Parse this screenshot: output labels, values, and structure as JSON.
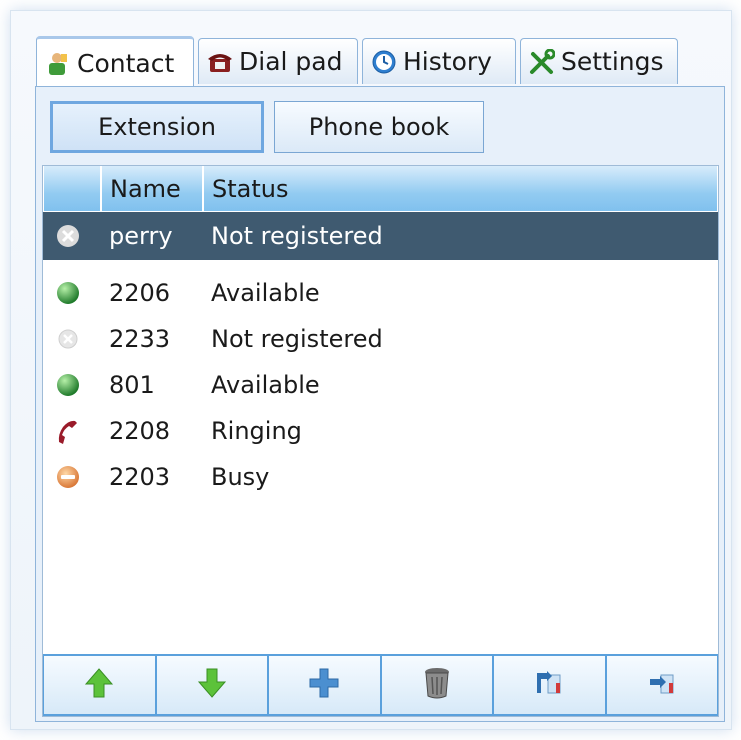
{
  "tabs": [
    {
      "label": "Contact",
      "icon": "contact-icon",
      "active": true
    },
    {
      "label": "Dial pad",
      "icon": "telephone-icon",
      "active": false
    },
    {
      "label": "History",
      "icon": "clock-icon",
      "active": false
    },
    {
      "label": "Settings",
      "icon": "tools-icon",
      "active": false
    }
  ],
  "segments": {
    "extension": "Extension",
    "phone_book": "Phone book"
  },
  "table": {
    "columns": [
      "",
      "Name",
      "Status"
    ],
    "rows": [
      {
        "name": "perry",
        "status": "Not registered",
        "icon": "not-registered-icon",
        "selected": true
      },
      {
        "name": "2206",
        "status": "Available",
        "icon": "available-icon"
      },
      {
        "name": "2233",
        "status": "Not registered",
        "icon": "not-registered-icon"
      },
      {
        "name": "801",
        "status": "Available",
        "icon": "available-icon"
      },
      {
        "name": "2208",
        "status": "Ringing",
        "icon": "ringing-handset-icon"
      },
      {
        "name": "2203",
        "status": "Busy",
        "icon": "busy-icon"
      }
    ]
  },
  "toolbar": [
    {
      "icon": "arrow-up-icon"
    },
    {
      "icon": "arrow-down-icon"
    },
    {
      "icon": "plus-icon"
    },
    {
      "icon": "trash-icon"
    },
    {
      "icon": "import-icon"
    },
    {
      "icon": "export-icon"
    }
  ],
  "colors": {
    "accent": "#8fb4da",
    "header": "#92cbf1",
    "selected_row": "#3f5a70",
    "available": "#2f9a3a",
    "ringing": "#9a1b2a",
    "busy": "#e0884a"
  }
}
